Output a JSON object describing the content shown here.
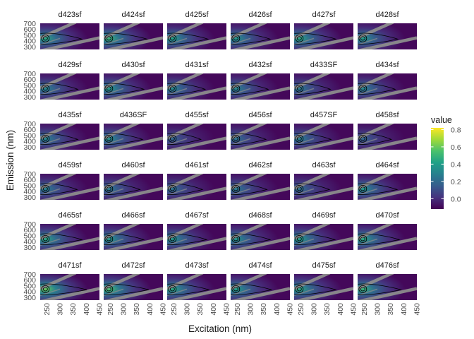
{
  "chart_data": {
    "type": "heatmap",
    "subtype": "faceted excitation-emission matrix with contour lines",
    "xlabel": "Excitation (nm)",
    "ylabel": "Emission (nm)",
    "x_ticks": [
      "250",
      "300",
      "350",
      "400",
      "450"
    ],
    "y_ticks": [
      "300",
      "400",
      "500",
      "600",
      "700"
    ],
    "xlim": [
      225,
      450
    ],
    "ylim": [
      250,
      700
    ],
    "layout": {
      "rows": 6,
      "cols": 6
    },
    "grid": true,
    "facets": [
      {
        "name": "d423sf",
        "peak": 0.45
      },
      {
        "name": "d424sf",
        "peak": 0.5
      },
      {
        "name": "d425sf",
        "peak": 0.42
      },
      {
        "name": "d426sf",
        "peak": 0.38
      },
      {
        "name": "d427sf",
        "peak": 0.45
      },
      {
        "name": "d428sf",
        "peak": 0.4
      },
      {
        "name": "d429sf",
        "peak": 0.32
      },
      {
        "name": "d430sf",
        "peak": 0.4
      },
      {
        "name": "d431sf",
        "peak": 0.33
      },
      {
        "name": "d432sf",
        "peak": 0.32
      },
      {
        "name": "d433SF",
        "peak": 0.28
      },
      {
        "name": "d434sf",
        "peak": 0.32
      },
      {
        "name": "d435sf",
        "peak": 0.32
      },
      {
        "name": "d436SF",
        "peak": 0.36
      },
      {
        "name": "d455sf",
        "peak": 0.2
      },
      {
        "name": "d456sf",
        "peak": 0.25
      },
      {
        "name": "d457SF",
        "peak": 0.3
      },
      {
        "name": "d458sf",
        "peak": 0.2
      },
      {
        "name": "d459sf",
        "peak": 0.3
      },
      {
        "name": "d460sf",
        "peak": 0.28
      },
      {
        "name": "d461sf",
        "peak": 0.25
      },
      {
        "name": "d462sf",
        "peak": 0.28
      },
      {
        "name": "d463sf",
        "peak": 0.25
      },
      {
        "name": "d464sf",
        "peak": 0.38
      },
      {
        "name": "d465sf",
        "peak": 0.45
      },
      {
        "name": "d466sf",
        "peak": 0.4
      },
      {
        "name": "d467sf",
        "peak": 0.38
      },
      {
        "name": "d468sf",
        "peak": 0.38
      },
      {
        "name": "d469sf",
        "peak": 0.42
      },
      {
        "name": "d470sf",
        "peak": 0.45
      },
      {
        "name": "d471sf",
        "peak": 0.6
      },
      {
        "name": "d472sf",
        "peak": 0.55
      },
      {
        "name": "d473sf",
        "peak": 0.45
      },
      {
        "name": "d474sf",
        "peak": 0.42
      },
      {
        "name": "d475sf",
        "peak": 0.45
      },
      {
        "name": "d476sf",
        "peak": 0.5
      }
    ],
    "legend": {
      "title": "value",
      "position": "right",
      "ticks": [
        "0.0",
        "0.2",
        "0.4",
        "0.6",
        "0.8"
      ],
      "tick_values": [
        0.0,
        0.2,
        0.4,
        0.6,
        0.8
      ],
      "range": [
        -0.12,
        0.82
      ],
      "palette": "viridis"
    },
    "colors": {
      "viridis": [
        "#440154",
        "#46327e",
        "#365c8d",
        "#277f8e",
        "#1fa187",
        "#4ac16d",
        "#a0da39",
        "#fde725"
      ],
      "background": "#440154",
      "scatter_lines": "#8c8c8c",
      "contour": "#000000"
    }
  }
}
